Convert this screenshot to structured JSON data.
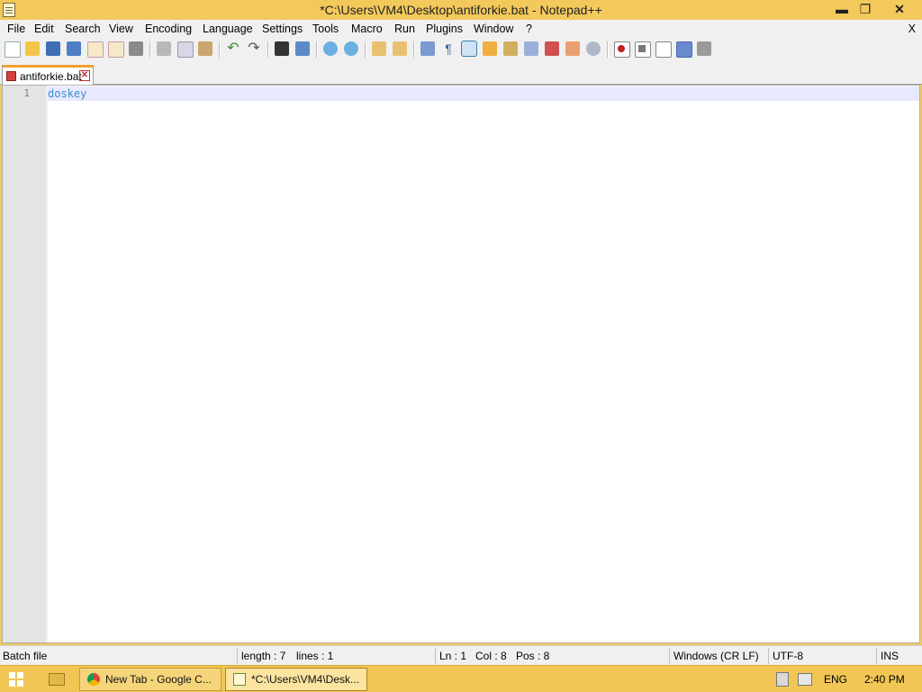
{
  "window": {
    "title": "*C:\\Users\\VM4\\Desktop\\antiforkie.bat - Notepad++",
    "minimize_symbol": "▬",
    "restore_symbol": "❐",
    "close_symbol": "✕"
  },
  "menu": {
    "items": [
      "File",
      "Edit",
      "Search",
      "View",
      "Encoding",
      "Language",
      "Settings",
      "Tools",
      "Macro",
      "Run",
      "Plugins",
      "Window",
      "?"
    ],
    "close_label": "X"
  },
  "toolbar": {
    "icons": [
      "new-file-icon",
      "open-file-icon",
      "save-icon",
      "save-all-icon",
      "close-icon",
      "close-all-icon",
      "print-icon",
      "cut-icon",
      "copy-icon",
      "paste-icon",
      "undo-icon",
      "redo-icon",
      "find-icon",
      "replace-icon",
      "zoom-in-icon",
      "zoom-out-icon",
      "sync-vertical-icon",
      "sync-horizontal-icon",
      "word-wrap-icon",
      "show-all-chars-icon",
      "indent-guide-icon",
      "user-language-icon",
      "document-map-icon",
      "function-list-icon",
      "folder-as-workspace-icon",
      "folder-icon",
      "monitoring-icon",
      "record-macro-icon",
      "stop-recording-icon",
      "play-macro-icon",
      "run-macro-multiple-icon",
      "save-macro-icon"
    ]
  },
  "tab": {
    "label": "antiforkie.bat",
    "close_symbol": "✕"
  },
  "editor": {
    "lines": [
      {
        "number": "1",
        "text": "doskey"
      }
    ]
  },
  "status": {
    "language": "Batch file",
    "length": "length : 7",
    "lines": "lines : 1",
    "ln": "Ln : 1",
    "col": "Col : 8",
    "pos": "Pos : 8",
    "eol": "Windows (CR LF)",
    "encoding": "UTF-8",
    "mode": "INS"
  },
  "taskbar": {
    "apps": [
      {
        "label": "New Tab - Google C...",
        "icon": "chrome-icon"
      },
      {
        "label": "*C:\\Users\\VM4\\Desk...",
        "icon": "notepadpp-icon"
      }
    ],
    "language": "ENG",
    "time": "2:40 PM"
  },
  "colors": {
    "accent": "#f3c95b",
    "code_text": "#3a8fd0",
    "current_line": "#e8e8ff",
    "tab_accent": "#f0a030"
  }
}
